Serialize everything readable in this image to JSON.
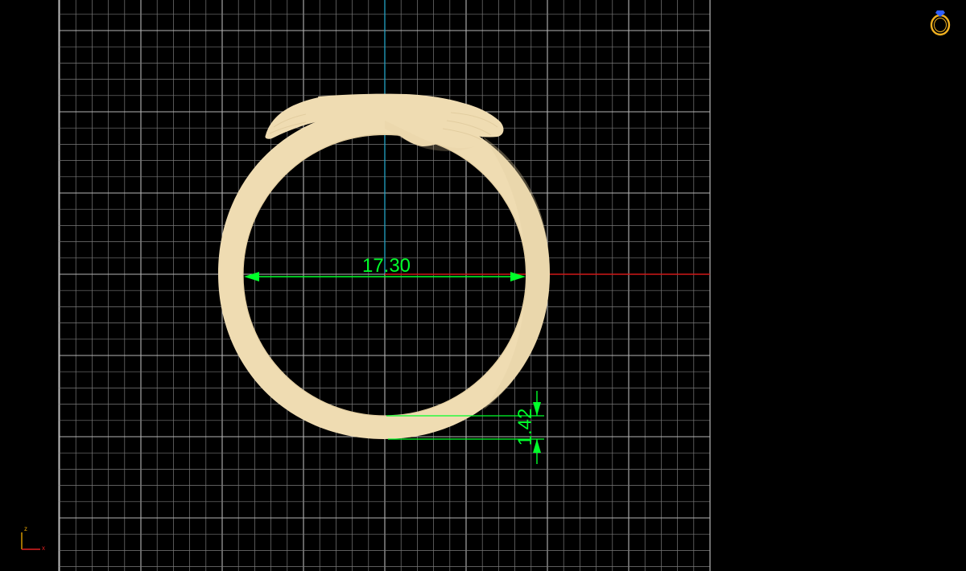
{
  "viewport": {
    "background": "#000000",
    "grid_color": "#7a7a7a",
    "grid_major_color": "#b5b5b5",
    "vertical_axis_color": "#1aa3c8",
    "horizontal_axis_color": "#d01818"
  },
  "model": {
    "name": "ring",
    "metal_color": "#efdcb2",
    "inner_shadow_color": "#e2cda0"
  },
  "dimensions": {
    "color": "#00ff2a",
    "inner_diameter": "17.30",
    "band_thickness": "1.42"
  },
  "axis_triad": {
    "vertical_label": "z",
    "horizontal_label": "x",
    "vertical_color": "#e0a000",
    "horizontal_color": "#e02020"
  },
  "view_cube": {
    "icon": "ring-icon",
    "icon_color": "#f0b020",
    "gem_color": "#3060ff"
  }
}
